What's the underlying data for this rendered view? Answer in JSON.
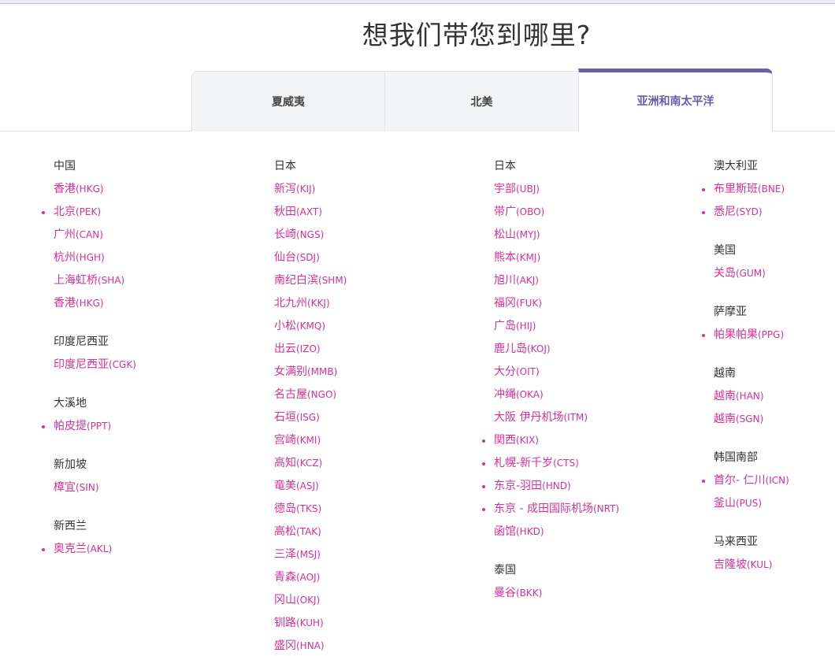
{
  "page_title": "想我们带您到哪里?",
  "tabs": [
    {
      "label": "夏威夷",
      "active": false
    },
    {
      "label": "北美",
      "active": false
    },
    {
      "label": "亚洲和南太平洋",
      "active": true
    }
  ],
  "colors": {
    "accent": "#6b5db0",
    "link": "#d82f98"
  },
  "columns": [
    [
      {
        "region": "中国",
        "cities": [
          {
            "name": "香港",
            "code": "(HKG)",
            "marked": false
          },
          {
            "name": "北京",
            "code": "(PEK)",
            "marked": true
          },
          {
            "name": "广州",
            "code": "(CAN)",
            "marked": false
          },
          {
            "name": "杭州",
            "code": "(HGH)",
            "marked": false
          },
          {
            "name": "上海虹桥",
            "code": "(SHA)",
            "marked": false
          },
          {
            "name": "香港",
            "code": "(HKG)",
            "marked": false
          }
        ]
      },
      {
        "region": "印度尼西亚",
        "cities": [
          {
            "name": "印度尼西亚",
            "code": "(CGK)",
            "marked": false
          }
        ]
      },
      {
        "region": "大溪地",
        "cities": [
          {
            "name": "帕皮提",
            "code": "(PPT)",
            "marked": true
          }
        ]
      },
      {
        "region": "新加坡",
        "cities": [
          {
            "name": "樟宜",
            "code": "(SIN)",
            "marked": false
          }
        ]
      },
      {
        "region": "新西兰",
        "cities": [
          {
            "name": "奥克兰",
            "code": "(AKL)",
            "marked": true
          }
        ]
      }
    ],
    [
      {
        "region": "日本",
        "cities": [
          {
            "name": "新泻",
            "code": "(KIJ)",
            "marked": false
          },
          {
            "name": "秋田",
            "code": "(AXT)",
            "marked": false
          },
          {
            "name": "长崎",
            "code": "(NGS)",
            "marked": false
          },
          {
            "name": "仙台",
            "code": "(SDJ)",
            "marked": false
          },
          {
            "name": "南纪白滨",
            "code": "(SHM)",
            "marked": false
          },
          {
            "name": "北九州",
            "code": "(KKJ)",
            "marked": false
          },
          {
            "name": "小松",
            "code": "(KMQ)",
            "marked": false
          },
          {
            "name": "出云",
            "code": "(IZO)",
            "marked": false
          },
          {
            "name": "女满别",
            "code": "(MMB)",
            "marked": false
          },
          {
            "name": "名古屋",
            "code": "(NGO)",
            "marked": false
          },
          {
            "name": "石垣",
            "code": "(ISG)",
            "marked": false
          },
          {
            "name": "宫崎",
            "code": "(KMI)",
            "marked": false
          },
          {
            "name": "高知",
            "code": "(KCZ)",
            "marked": false
          },
          {
            "name": "竜美",
            "code": "(ASJ)",
            "marked": false
          },
          {
            "name": "德岛",
            "code": "(TKS)",
            "marked": false
          },
          {
            "name": "高松",
            "code": "(TAK)",
            "marked": false
          },
          {
            "name": "三泽",
            "code": "(MSJ)",
            "marked": false
          },
          {
            "name": "青森",
            "code": "(AOJ)",
            "marked": false
          },
          {
            "name": "冈山",
            "code": "(OKJ)",
            "marked": false
          },
          {
            "name": "钏路",
            "code": "(KUH)",
            "marked": false
          },
          {
            "name": "盛冈",
            "code": "(HNA)",
            "marked": false
          }
        ]
      }
    ],
    [
      {
        "region": "日本",
        "cities": [
          {
            "name": "宇部",
            "code": "(UBJ)",
            "marked": false
          },
          {
            "name": "带广",
            "code": "(OBO)",
            "marked": false
          },
          {
            "name": "松山",
            "code": "(MYJ)",
            "marked": false
          },
          {
            "name": "熊本",
            "code": "(KMJ)",
            "marked": false
          },
          {
            "name": "旭川",
            "code": "(AKJ)",
            "marked": false
          },
          {
            "name": "福冈",
            "code": "(FUK)",
            "marked": false
          },
          {
            "name": "广岛",
            "code": "(HIJ)",
            "marked": false
          },
          {
            "name": "鹿儿岛",
            "code": "(KOJ)",
            "marked": false
          },
          {
            "name": "大分",
            "code": "(OIT)",
            "marked": false
          },
          {
            "name": "冲绳",
            "code": "(OKA)",
            "marked": false
          },
          {
            "name": "大阪 伊丹机场",
            "code": "(ITM)",
            "marked": false
          },
          {
            "name": "関西",
            "code": "(KIX)",
            "marked": true
          },
          {
            "name": "札幌-新千岁",
            "code": "(CTS)",
            "marked": true
          },
          {
            "name": "东京-羽田",
            "code": "(HND)",
            "marked": true
          },
          {
            "name": "东京 - 成田国际机场",
            "code": "(NRT)",
            "marked": true
          },
          {
            "name": "函馆",
            "code": "(HKD)",
            "marked": false
          }
        ]
      },
      {
        "region": "泰国",
        "cities": [
          {
            "name": "曼谷",
            "code": "(BKK)",
            "marked": false
          }
        ]
      }
    ],
    [
      {
        "region": "澳大利亚",
        "cities": [
          {
            "name": "布里斯班",
            "code": "(BNE)",
            "marked": true
          },
          {
            "name": "悉尼",
            "code": "(SYD)",
            "marked": true
          }
        ]
      },
      {
        "region": "美国",
        "cities": [
          {
            "name": "关岛",
            "code": "(GUM)",
            "marked": false
          }
        ]
      },
      {
        "region": "萨摩亚",
        "cities": [
          {
            "name": "帕果帕果",
            "code": "(PPG)",
            "marked": true
          }
        ]
      },
      {
        "region": "越南",
        "cities": [
          {
            "name": "越南",
            "code": "(HAN)",
            "marked": false
          },
          {
            "name": "越南",
            "code": "(SGN)",
            "marked": false
          }
        ]
      },
      {
        "region": "韩国南部",
        "cities": [
          {
            "name": "首尔- 仁川",
            "code": "(ICN)",
            "marked": true
          },
          {
            "name": "釜山",
            "code": "(PUS)",
            "marked": false
          }
        ]
      },
      {
        "region": "马来西亚",
        "cities": [
          {
            "name": "吉隆坡",
            "code": "(KUL)",
            "marked": false
          }
        ]
      }
    ]
  ]
}
